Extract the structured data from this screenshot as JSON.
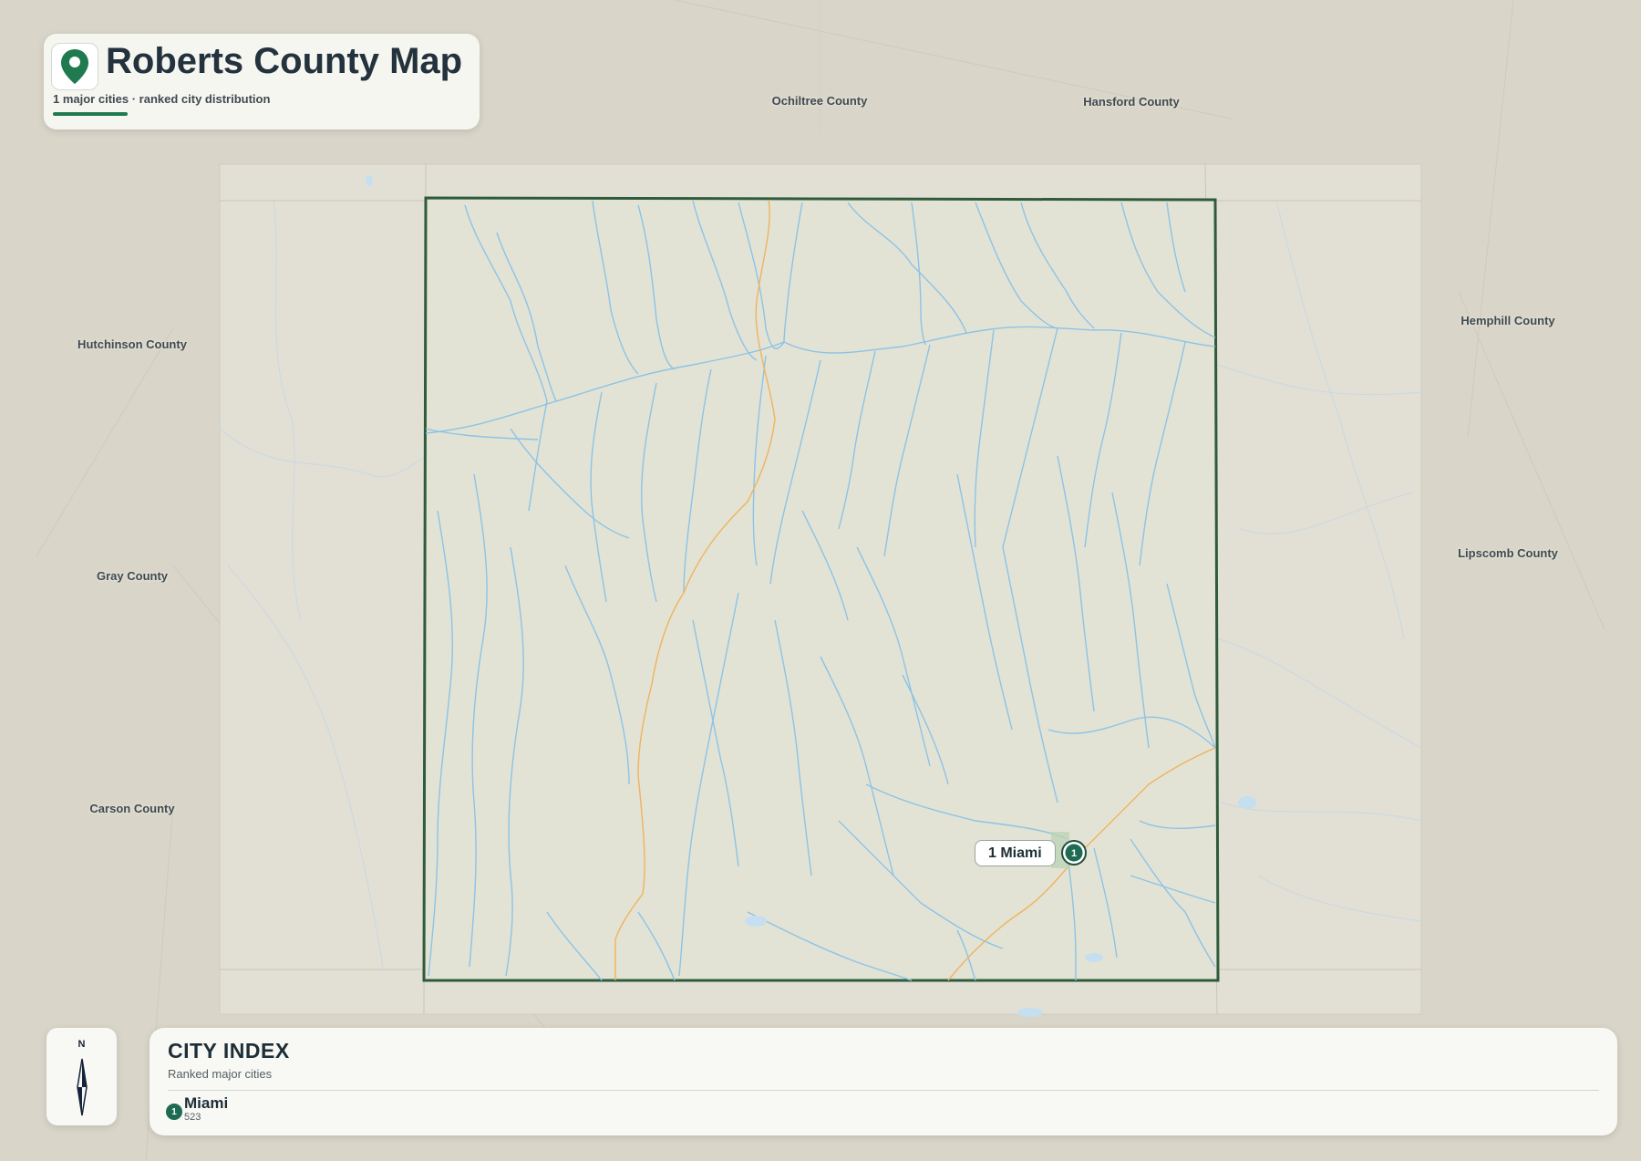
{
  "title": {
    "text": "Roberts County Map",
    "subtitle": "1 major cities · ranked city distribution",
    "accent_color": "#1f7a4f",
    "icon": "map-pin-icon"
  },
  "map": {
    "county_border_color": "#2e5b3a",
    "river_color": "#8dc3e6",
    "road_color": "#f0b35b",
    "neighbor_counties": [
      {
        "id": "ochiltree",
        "name": "Ochiltree County"
      },
      {
        "id": "hansford",
        "name": "Hansford County"
      },
      {
        "id": "hutchinson",
        "name": "Hutchinson County"
      },
      {
        "id": "gray",
        "name": "Gray County"
      },
      {
        "id": "carson",
        "name": "Carson County"
      },
      {
        "id": "hemphill",
        "name": "Hemphill County"
      },
      {
        "id": "lipscomb",
        "name": "Lipscomb County"
      }
    ],
    "city_marker": {
      "rank": "1",
      "name": "Miami",
      "label": "1 Miami"
    }
  },
  "compass": {
    "north_label": "N",
    "icon": "compass-needle-icon"
  },
  "city_index": {
    "title": "CITY INDEX",
    "subtitle": "Ranked major cities",
    "items": [
      {
        "rank": "1",
        "name": "Miami",
        "population": "523"
      }
    ]
  }
}
